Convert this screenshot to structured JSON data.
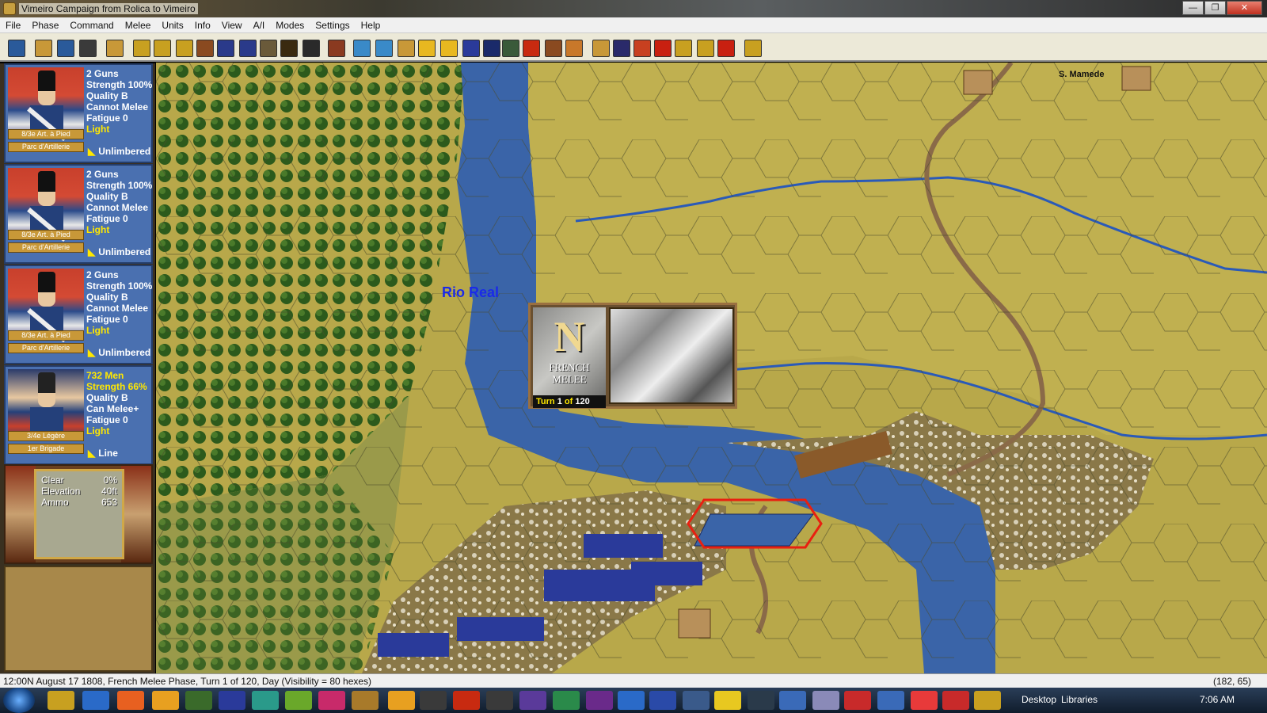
{
  "window": {
    "title": "Vimeiro Campaign from Rolica to Vimeiro",
    "min": "—",
    "max": "❐",
    "close": "✕"
  },
  "menu": [
    "File",
    "Phase",
    "Command",
    "Melee",
    "Units",
    "Info",
    "View",
    "A/I",
    "Modes",
    "Settings",
    "Help"
  ],
  "units": [
    {
      "line1": "2 Guns",
      "line2": "Strength 100%",
      "line3": "Quality B",
      "line4": "Cannot Melee",
      "line5": "Fatigue 0",
      "line6": "Light",
      "unit": "8/3e Art. à Pied",
      "parent": "Parc d'Artillerie",
      "formation": "Unlimbered"
    },
    {
      "line1": "2 Guns",
      "line2": "Strength 100%",
      "line3": "Quality B",
      "line4": "Cannot Melee",
      "line5": "Fatigue 0",
      "line6": "Light",
      "unit": "8/3e Art. à Pied",
      "parent": "Parc d'Artillerie",
      "formation": "Unlimbered"
    },
    {
      "line1": "2 Guns",
      "line2": "Strength 100%",
      "line3": "Quality B",
      "line4": "Cannot Melee",
      "line5": "Fatigue 0",
      "line6": "Light",
      "unit": "8/3e Art. à Pied",
      "parent": "Parc d'Artillerie",
      "formation": "Unlimbered"
    },
    {
      "line1": "732 Men",
      "line2": "Strength 66%",
      "line3": "Quality B",
      "line4": "Can Melee+",
      "line5": "Fatigue 0",
      "line6": "Light",
      "unit": "3/4e Légère",
      "parent": "1er Brigade",
      "formation": "Line"
    }
  ],
  "terrain": {
    "type": "Clear",
    "type_val": "0%",
    "elev_label": "Elevation",
    "elev_val": "40ft",
    "ammo_label": "Ammo",
    "ammo_val": "653"
  },
  "map": {
    "river_label": "Rio Real",
    "town_label": "S. Mamede"
  },
  "turn": {
    "letter": "N",
    "phase_line1": "FRENCH",
    "phase_line2": "MELEE",
    "turn_word": "Turn",
    "turn_num": "1",
    "of_word": "of",
    "turn_max": "120"
  },
  "status": {
    "text": "12:00N  August 17 1808, French Melee Phase, Turn 1 of 120, Day (Visibility = 80 hexes)",
    "coord": "(182, 65)"
  },
  "taskbar": {
    "desktop": "Desktop",
    "libraries": "Libraries",
    "clock": "7:06 AM"
  },
  "colors": {
    "river": "#3a64a8",
    "grass": "#b8a84a",
    "forest": "#2c5a1c",
    "road": "#8a6a48"
  }
}
